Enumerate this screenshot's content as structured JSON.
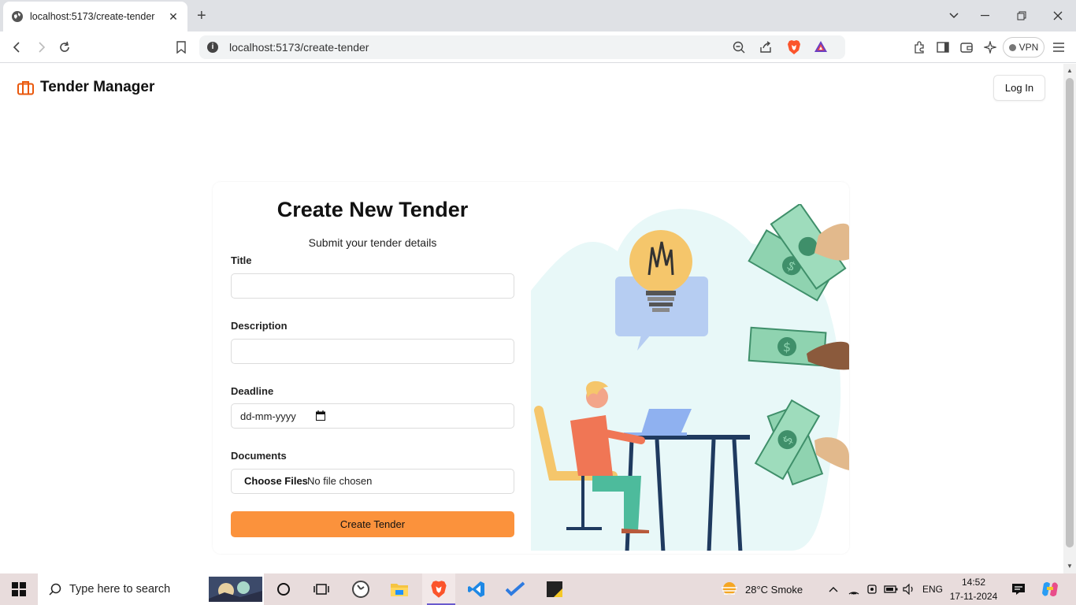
{
  "browser": {
    "tab_title": "localhost:5173/create-tender",
    "url": "localhost:5173/create-tender",
    "vpn_label": "VPN"
  },
  "header": {
    "brand": "Tender Manager",
    "login": "Log In"
  },
  "form": {
    "title": "Create New Tender",
    "subtitle": "Submit your tender details",
    "fields": {
      "title_label": "Title",
      "description_label": "Description",
      "deadline_label": "Deadline",
      "deadline_placeholder": "dd-mm-yyyy",
      "documents_label": "Documents",
      "choose_files": "Choose Files",
      "no_file": "No file chosen"
    },
    "submit": "Create Tender"
  },
  "taskbar": {
    "search_placeholder": "Type here to search",
    "weather": "28°C  Smoke",
    "language": "ENG",
    "time": "14:52",
    "date": "17-11-2024"
  },
  "colors": {
    "accent": "#fb923c",
    "brand_icon": "#ea580c",
    "blob": "#e8f8f8",
    "money": "#8fd3b0"
  }
}
